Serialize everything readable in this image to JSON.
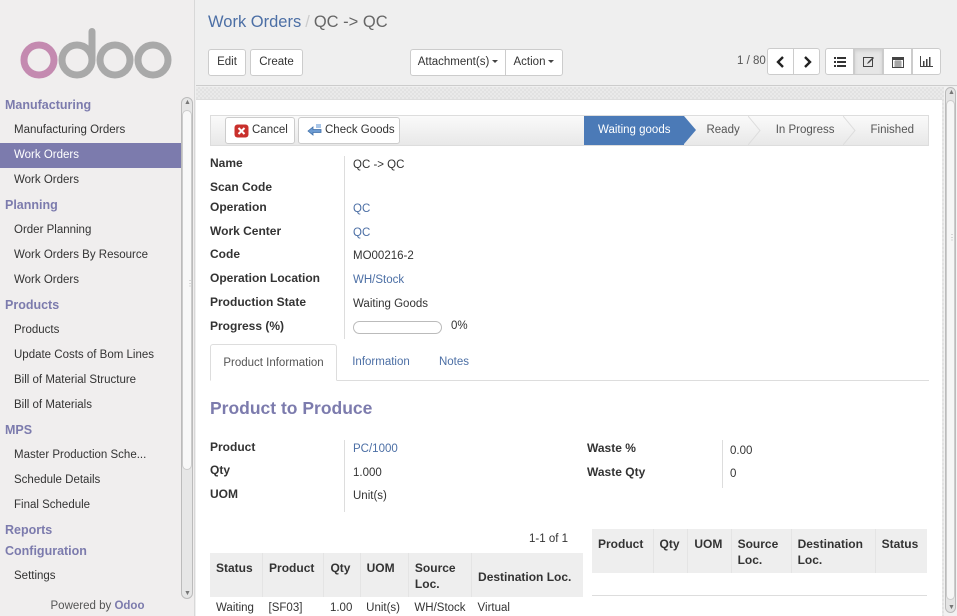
{
  "sidebar": {
    "logo_text": "odoo",
    "sections": [
      {
        "heading": "Manufacturing",
        "items": [
          {
            "label": "Manufacturing Orders",
            "active": false
          },
          {
            "label": "Work Orders",
            "active": true
          },
          {
            "label": "Work Orders",
            "active": false
          }
        ]
      },
      {
        "heading": "Planning",
        "items": [
          {
            "label": "Order Planning",
            "active": false
          },
          {
            "label": "Work Orders By Resource",
            "active": false
          },
          {
            "label": "Work Orders",
            "active": false
          }
        ]
      },
      {
        "heading": "Products",
        "items": [
          {
            "label": "Products",
            "active": false
          },
          {
            "label": "Update Costs of Bom Lines",
            "active": false
          },
          {
            "label": "Bill of Material Structure",
            "active": false
          },
          {
            "label": "Bill of Materials",
            "active": false
          }
        ]
      },
      {
        "heading": "MPS",
        "items": [
          {
            "label": "Master Production Sche...",
            "active": false
          },
          {
            "label": "Schedule Details",
            "active": false
          },
          {
            "label": "Final Schedule",
            "active": false
          }
        ]
      },
      {
        "heading": "Reports",
        "items": []
      },
      {
        "heading": "Configuration",
        "items": [
          {
            "label": "Settings",
            "active": false
          }
        ]
      }
    ],
    "powered_by": "Powered by",
    "powered_brand": "Odoo"
  },
  "header": {
    "breadcrumb_parent": "Work Orders",
    "breadcrumb_sep": "/",
    "breadcrumb_current": "QC -> QC",
    "edit_label": "Edit",
    "create_label": "Create",
    "attachments_label": "Attachment(s)",
    "action_label": "Action",
    "pager": "1 / 80",
    "views": [
      "list-view-icon",
      "form-view-icon",
      "calendar-view-icon",
      "graph-view-icon"
    ],
    "active_view": "form-view-icon"
  },
  "statusbar": {
    "cancel_label": "Cancel",
    "check_goods_label": "Check Goods",
    "states": [
      "Waiting goods",
      "Ready",
      "In Progress",
      "Finished"
    ],
    "active_state": "Waiting goods"
  },
  "form": {
    "fields": [
      {
        "label": "Name",
        "value": "QC -> QC",
        "link": false
      },
      {
        "label": "Scan Code",
        "value": "",
        "link": false
      },
      {
        "label": "Operation",
        "value": "QC",
        "link": true
      },
      {
        "label": "Work Center",
        "value": "QC",
        "link": true
      },
      {
        "label": "Code",
        "value": "MO00216-2",
        "link": false
      },
      {
        "label": "Operation Location",
        "value": "WH/Stock",
        "link": true
      },
      {
        "label": "Production State",
        "value": "Waiting Goods",
        "link": false
      },
      {
        "label": "Progress (%)",
        "value": "0%",
        "link": false
      }
    ],
    "progress_percent": 0,
    "tabs": [
      "Product Information",
      "Information",
      "Notes"
    ],
    "active_tab": "Product Information",
    "section_title": "Product to Produce",
    "left_fields": [
      {
        "label": "Product",
        "value": "PC/1000",
        "link": true
      },
      {
        "label": "Qty",
        "value": "1.000",
        "link": false
      },
      {
        "label": "UOM",
        "value": "Unit(s)",
        "link": false
      }
    ],
    "right_fields": [
      {
        "label": "Waste %",
        "value": "0.00"
      },
      {
        "label": "Waste Qty",
        "value": "0"
      }
    ],
    "moves_pager": "1-1 of 1",
    "moves_table": {
      "columns": [
        "Status",
        "Product",
        "Qty",
        "UOM",
        "Source Loc.",
        "Destination Loc."
      ],
      "rows": [
        [
          "Waiting",
          "[SF03]",
          "1.00",
          "Unit(s)",
          "WH/Stock",
          "Virtual"
        ]
      ]
    },
    "finished_table": {
      "columns": [
        "Product",
        "Qty",
        "UOM",
        "Source Loc.",
        "Destination Loc.",
        "Status"
      ],
      "rows": []
    }
  },
  "colors": {
    "brand": "#7c7bad",
    "link": "#4c6fa5",
    "state_active": "#4b7ab7"
  }
}
